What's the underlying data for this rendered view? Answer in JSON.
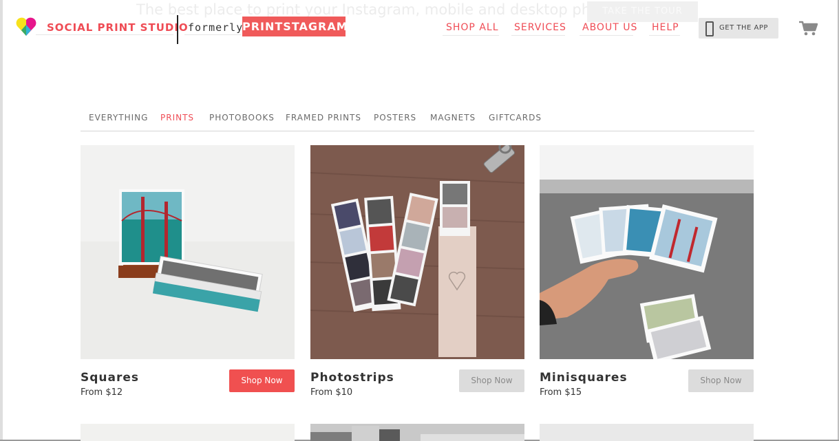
{
  "header": {
    "tagline": "The best place to print your Instagram, mobile and desktop photos",
    "tour_button": "TAKE THE TOUR",
    "brand": "SOCIAL PRINT STUDIO",
    "formerly": "formerly",
    "old_brand": "PRINTSTAGRAM",
    "nav": [
      "SHOP ALL",
      "SERVICES",
      "ABOUT US",
      "HELP"
    ],
    "app_button": "GET THE APP",
    "accent_color": "#ef4c55"
  },
  "tabs": {
    "items": [
      "EVERYTHING",
      "PRINTS",
      "PHOTOBOOKS",
      "FRAMED PRINTS",
      "POSTERS",
      "MAGNETS",
      "GIFTCARDS"
    ],
    "active": "PRINTS"
  },
  "products": [
    {
      "name": "Squares",
      "price": "From $12",
      "button": "Shop Now",
      "button_style": "primary"
    },
    {
      "name": "Photostrips",
      "price": "From $10",
      "button": "Shop Now",
      "button_style": "secondary"
    },
    {
      "name": "Minisquares",
      "price": "From $15",
      "button": "Shop Now",
      "button_style": "secondary"
    }
  ]
}
